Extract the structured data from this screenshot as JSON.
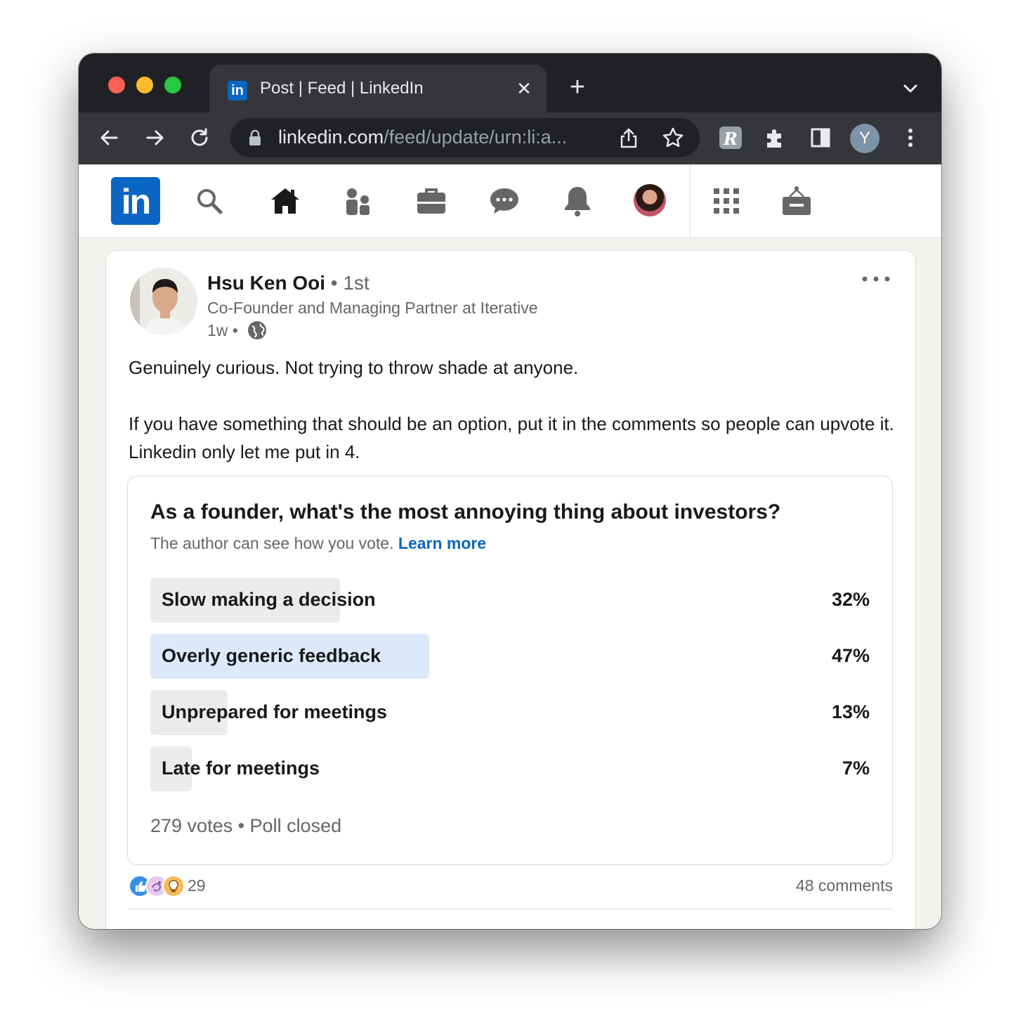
{
  "browser": {
    "tab_title": "Post | Feed | LinkedIn",
    "favicon_text": "in",
    "url_domain": "linkedin.com",
    "url_path": "/feed/update/urn:li:a...",
    "profile_initial": "Y",
    "colors": {
      "frame": "#202124",
      "toolbar": "#35363a",
      "close": "#ff5f57",
      "minimize": "#febc2e",
      "zoom": "#28c840"
    }
  },
  "linkedin_nav": {
    "logo_text": "in",
    "icons": [
      "search-icon",
      "home-icon",
      "my-network-icon",
      "jobs-icon",
      "messaging-icon",
      "notifications-icon",
      "me-avatar",
      "work-grid-icon",
      "advertise-icon"
    ],
    "brand_color": "#0a66c2"
  },
  "post": {
    "author_name": "Hsu Ken Ooi",
    "degree": "• 1st",
    "headline": "Co-Founder and Managing Partner at Iterative",
    "time": "1w •",
    "body_paragraph_1": "Genuinely curious. Not trying to throw shade at anyone.",
    "body_paragraph_2": "If you have something that should be an option, put it in the comments so people can upvote it. Linkedin only let me put in 4.",
    "poll": {
      "question": "As a founder, what's the most annoying thing about investors?",
      "note": "The author can see how you vote.",
      "learn_more": "Learn more",
      "options": [
        {
          "label": "Slow making a decision",
          "percent_text": "32%",
          "percent": 32,
          "selected": false
        },
        {
          "label": "Overly generic feedback",
          "percent_text": "47%",
          "percent": 47,
          "selected": true
        },
        {
          "label": "Unprepared for meetings",
          "percent_text": "13%",
          "percent": 13,
          "selected": false
        },
        {
          "label": "Late for meetings",
          "percent_text": "7%",
          "percent": 7,
          "selected": false
        }
      ],
      "footer": "279 votes • Poll closed"
    },
    "reaction_count": "29",
    "comments": "48 comments"
  }
}
